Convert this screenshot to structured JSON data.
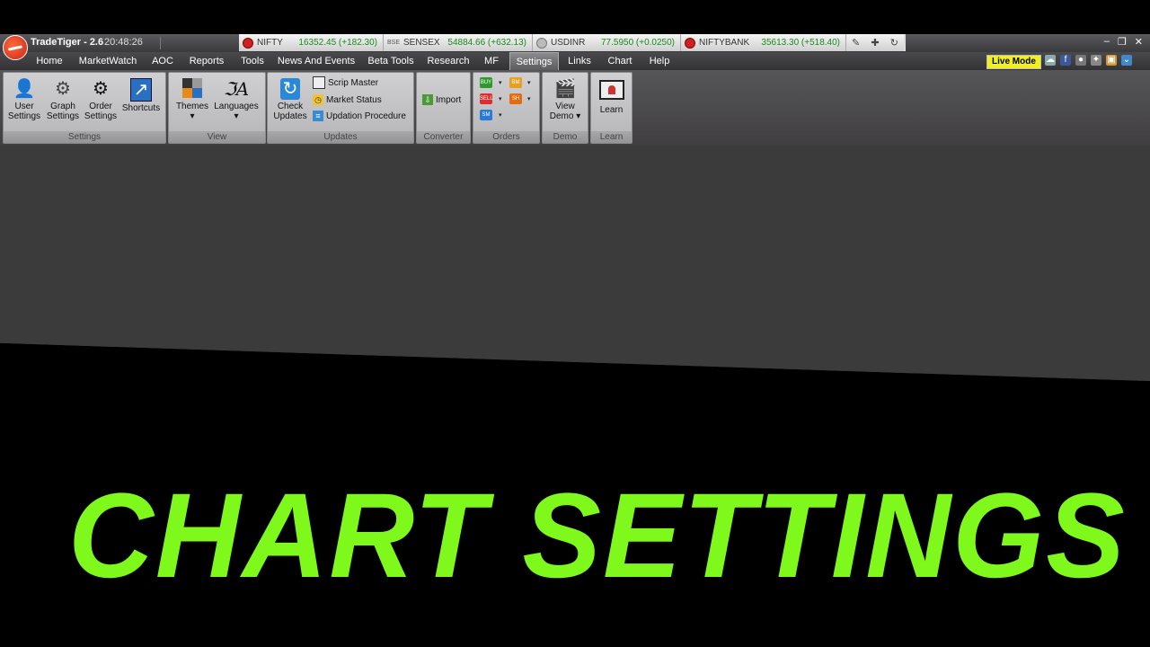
{
  "app": {
    "title": "TradeTiger - 2.6",
    "time": "20:48:26"
  },
  "ticker": [
    {
      "name": "NIFTY",
      "value": "16352.45 (+182.30)",
      "icon": "red-circle-icon"
    },
    {
      "name": "SENSEX",
      "value": "54884.66 (+632.13)",
      "icon": "bse-icon"
    },
    {
      "name": "USDINR",
      "value": "77.5950 (+0.0250)",
      "icon": "gray-circle-icon"
    },
    {
      "name": "NIFTYBANK",
      "value": "35613.30 (+518.40)",
      "icon": "red-circle-icon"
    }
  ],
  "menu": [
    "Home",
    "MarketWatch",
    "AOC",
    "Reports",
    "Tools",
    "News And Events",
    "Beta Tools",
    "Research",
    "MF",
    "Settings",
    "Links",
    "Chart",
    "Help"
  ],
  "active_menu": "Settings",
  "live_mode": "Live Mode",
  "ribbon": {
    "settings": {
      "label": "Settings",
      "user": [
        "User",
        "Settings"
      ],
      "graph": [
        "Graph",
        "Settings"
      ],
      "order": [
        "Order",
        "Settings"
      ],
      "shortcuts": "Shortcuts"
    },
    "view": {
      "label": "View",
      "themes": "Themes",
      "languages": "Languages"
    },
    "updates": {
      "label": "Updates",
      "check": [
        "Check",
        "Updates"
      ],
      "scrip": "Scrip Master",
      "market": "Market Status",
      "procedure": "Updation Procedure"
    },
    "converter": {
      "label": "Converter",
      "import": "Import"
    },
    "orders": {
      "label": "Orders",
      "buy": "BUY",
      "sell": "SELL",
      "bm": "BM",
      "sh": "SH",
      "sm": "SM"
    },
    "demo": {
      "label": "Demo",
      "view": [
        "View",
        "Demo"
      ]
    },
    "learn": {
      "label": "Learn",
      "learn": "Learn"
    }
  },
  "overlay_title": "CHART SETTINGS",
  "colors": {
    "title_green": "#7ff81c",
    "live_yellow": "#f0f020",
    "ticker_green": "#188a18"
  }
}
